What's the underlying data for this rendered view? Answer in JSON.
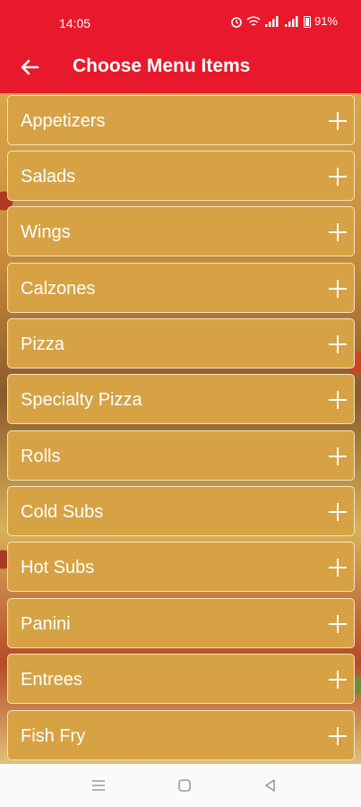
{
  "status_bar": {
    "time": "14:05",
    "battery": "91%",
    "icons": [
      "alarm-icon",
      "wifi-icon",
      "signal-icon",
      "signal-icon",
      "battery-icon"
    ]
  },
  "app_bar": {
    "title": "Choose Menu Items",
    "back_icon": "back-arrow-icon"
  },
  "colors": {
    "header": "#e8192c",
    "item_bg": "#d6a244",
    "item_text": "#ffffff"
  },
  "menu_items": [
    {
      "label": "Appetizers"
    },
    {
      "label": "Salads"
    },
    {
      "label": "Wings"
    },
    {
      "label": "Calzones"
    },
    {
      "label": "Pizza"
    },
    {
      "label": "Specialty Pizza"
    },
    {
      "label": "Rolls"
    },
    {
      "label": "Cold Subs"
    },
    {
      "label": "Hot Subs"
    },
    {
      "label": "Panini"
    },
    {
      "label": "Entrees"
    },
    {
      "label": "Fish Fry"
    }
  ],
  "nav_bar": [
    "menu-icon",
    "home-icon",
    "back-icon"
  ]
}
